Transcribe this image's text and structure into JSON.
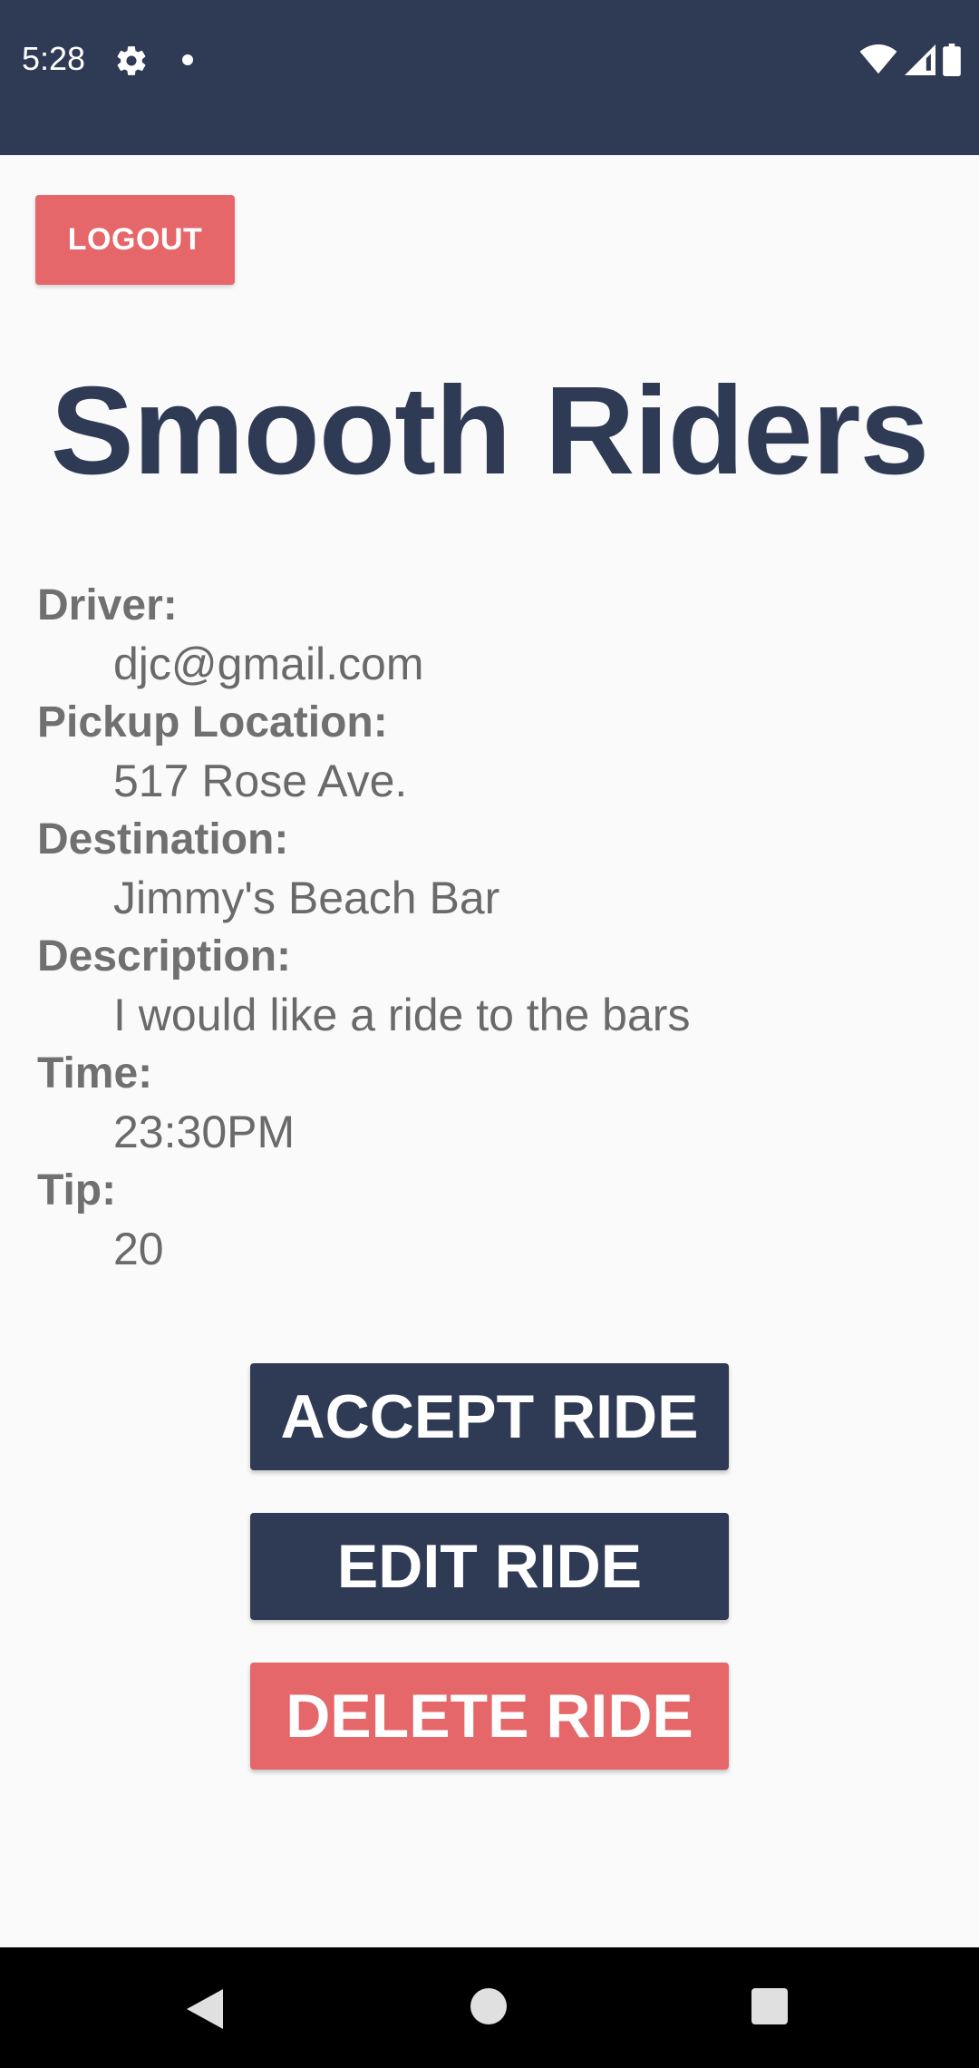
{
  "status_bar": {
    "time": "5:28",
    "icons": [
      "gear-icon",
      "notification-dot-icon",
      "wifi-icon",
      "signal-icon",
      "battery-icon"
    ],
    "background_color": "#2f3a55"
  },
  "header": {
    "logout_label": "LOGOUT"
  },
  "app_title": "Smooth Riders",
  "ride": {
    "driver_label": "Driver:",
    "driver_value": "djc@gmail.com",
    "pickup_label": "Pickup Location:",
    "pickup_value": "517 Rose Ave.",
    "destination_label": "Destination:",
    "destination_value": "Jimmy's Beach Bar",
    "description_label": "Description:",
    "description_value": "I would like a ride to the bars",
    "time_label": "Time:",
    "time_value": "23:30PM",
    "tip_label": "Tip:",
    "tip_value": "20"
  },
  "actions": {
    "accept_label": "ACCEPT RIDE",
    "edit_label": "EDIT RIDE",
    "delete_label": "DELETE RIDE"
  },
  "colors": {
    "primary": "#2f3a55",
    "danger": "#e5676a",
    "text_gray": "#707070"
  },
  "nav_bar": {
    "icons": [
      "back-icon",
      "home-icon",
      "recent-apps-icon"
    ]
  }
}
